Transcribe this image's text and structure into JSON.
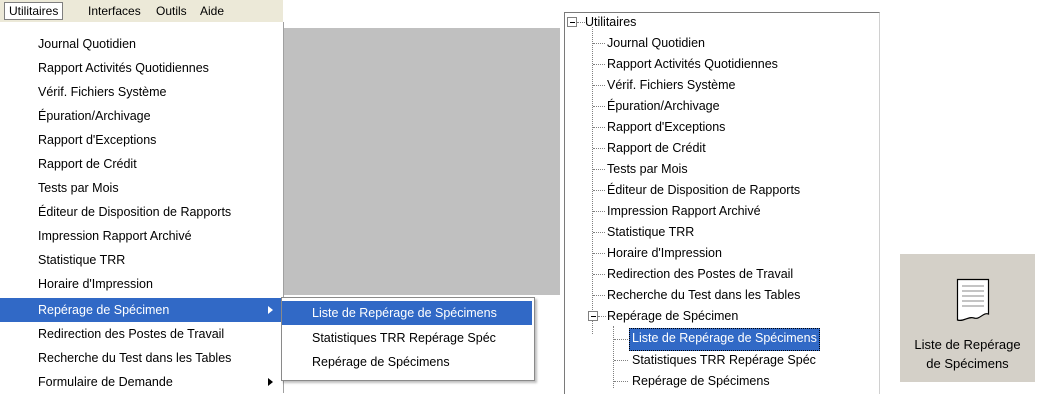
{
  "menubar": {
    "items": [
      "Utilitaires",
      "Interfaces",
      "Outils",
      "Aide"
    ]
  },
  "dropdown": {
    "items": [
      "Journal Quotidien",
      "Rapport Activités Quotidiennes",
      "Vérif. Fichiers Système",
      "Épuration/Archivage",
      "Rapport d'Exceptions",
      "Rapport de Crédit",
      "Tests par Mois",
      "Éditeur de Disposition de Rapports",
      "Impression Rapport Archivé",
      "Statistique TRR",
      "Horaire d'Impression",
      "Repérage de Spécimen",
      "Redirection des Postes de Travail",
      "Recherche du Test dans les Tables",
      "Formulaire de Demande"
    ],
    "selected_index": 11
  },
  "submenu": {
    "items": [
      "Liste de Repérage de Spécimens",
      "Statistiques TRR Repérage Spéc",
      "Repérage de Spécimens"
    ],
    "selected_index": 0
  },
  "tree": {
    "root": "Utilitaires",
    "children": [
      "Journal Quotidien",
      "Rapport Activités Quotidiennes",
      "Vérif. Fichiers Système",
      "Épuration/Archivage",
      "Rapport d'Exceptions",
      "Rapport de Crédit",
      "Tests par Mois",
      "Éditeur de Disposition de Rapports",
      "Impression Rapport Archivé",
      "Statistique TRR",
      "Horaire d'Impression",
      "Redirection des Postes de Travail",
      "Recherche du Test dans les Tables"
    ],
    "expanded_node": "Repérage de Spécimen",
    "expanded_children": [
      "Liste de Repérage de Spécimens",
      "Statistiques TRR Repérage Spéc",
      "Repérage de Spécimens"
    ],
    "selected": "Liste de Repérage de Spécimens"
  },
  "tile": {
    "icon": "document-icon",
    "label_line1": "Liste de Repérage",
    "label_line2": "de Spécimens"
  },
  "colors": {
    "selection": "#3169c6",
    "menubar": "#ece9d8",
    "tile_bg": "#d4d0c8",
    "grey_area": "#c0c0c0"
  }
}
